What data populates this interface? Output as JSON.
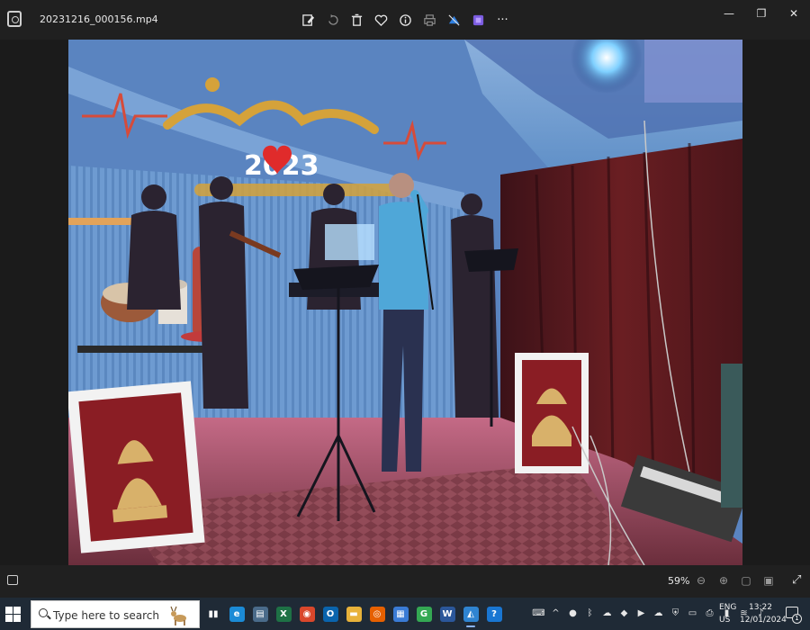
{
  "window": {
    "file_name": "20231216_000156.mp4",
    "controls": {
      "minimize": "—",
      "maximize": "❐",
      "close": "✕"
    }
  },
  "toolbar": {
    "icons": [
      "edit-icon",
      "rotate-icon",
      "delete-icon",
      "favorite-icon",
      "info-icon",
      "print-icon",
      "sync-icon",
      "clipchamp-icon",
      "more-icon"
    ],
    "more_label": "···"
  },
  "photo": {
    "banner_year": "2023",
    "colors": {
      "backdrop": "#5f8fc7",
      "curtain": "#6a1e22",
      "banner_gold": "#d5a23a",
      "stage_cloth": "#7a3a45"
    }
  },
  "viewbar": {
    "zoom_level": "59%",
    "expand_glyph": "⤢"
  },
  "taskbar": {
    "search_placeholder": "Type here to search",
    "apps": [
      {
        "name": "task-view",
        "glyph": "▮▮",
        "color": "#1f2a36"
      },
      {
        "name": "edge",
        "glyph": "e",
        "color": "#1b8bd6"
      },
      {
        "name": "file-manager",
        "glyph": "▤",
        "color": "#4a6b8a"
      },
      {
        "name": "excel",
        "glyph": "X",
        "color": "#1e7145"
      },
      {
        "name": "chrome",
        "glyph": "◉",
        "color": "#d9472b"
      },
      {
        "name": "outlook",
        "glyph": "O",
        "color": "#0a64ad"
      },
      {
        "name": "explorer",
        "glyph": "▬",
        "color": "#e8b23a"
      },
      {
        "name": "firefox",
        "glyph": "◎",
        "color": "#e66000"
      },
      {
        "name": "store",
        "glyph": "▦",
        "color": "#3a7bd5"
      },
      {
        "name": "chrome-2",
        "glyph": "G",
        "color": "#34a853"
      },
      {
        "name": "word",
        "glyph": "W",
        "color": "#2b579a"
      },
      {
        "name": "photos",
        "glyph": "◭",
        "color": "#2f84d1"
      },
      {
        "name": "help",
        "glyph": "?",
        "color": "#1976d2"
      }
    ],
    "tray_icons": [
      "keyboard-icon",
      "chevron-up-icon",
      "antivirus-icon",
      "bluetooth-icon",
      "cloud-icon",
      "app-icon",
      "meet-icon",
      "onedrive-icon",
      "security-icon",
      "display-icon",
      "printer-icon",
      "battery-icon",
      "wifi-icon",
      "volume-icon"
    ],
    "language": {
      "line1": "ENG",
      "line2": "US"
    },
    "clock": {
      "time": "13:22",
      "date": "12/01/2024"
    },
    "notification_count": "1"
  }
}
